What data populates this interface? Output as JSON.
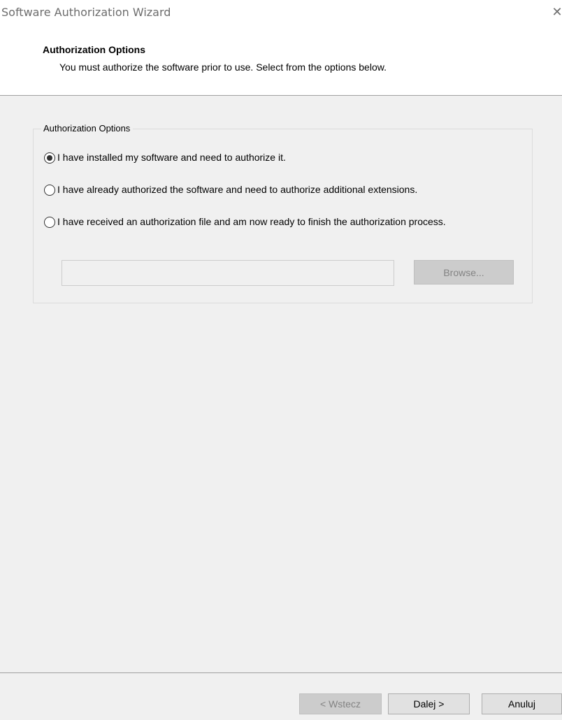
{
  "window": {
    "title": "Software Authorization Wizard",
    "close_glyph": "✕"
  },
  "header": {
    "title": "Authorization Options",
    "subtitle": "You must authorize the software prior to use. Select from the options below."
  },
  "options_group": {
    "legend": "Authorization Options",
    "selected_index": 0,
    "options": [
      {
        "label": "I have installed my software and need to authorize it.",
        "checked": true
      },
      {
        "label": "I have already authorized the software and need to authorize additional extensions.",
        "checked": false
      },
      {
        "label": "I have received an authorization file and am now ready to finish the authorization process.",
        "checked": false
      }
    ],
    "file_path_value": "",
    "browse_label": "Browse..."
  },
  "footer": {
    "back_label": "< Wstecz",
    "next_label": "Dalej >",
    "cancel_label": "Anuluj"
  },
  "colors": {
    "window_bg": "#ffffff",
    "body_bg": "#f0f0f0",
    "disabled_button_bg": "#cccccc",
    "disabled_text": "#838383",
    "button_bg": "#e1e1e1",
    "button_border": "#adadad"
  },
  "icons": {
    "close": "close-icon",
    "radio_checked": "radio-checked-icon",
    "radio_unchecked": "radio-unchecked-icon"
  }
}
